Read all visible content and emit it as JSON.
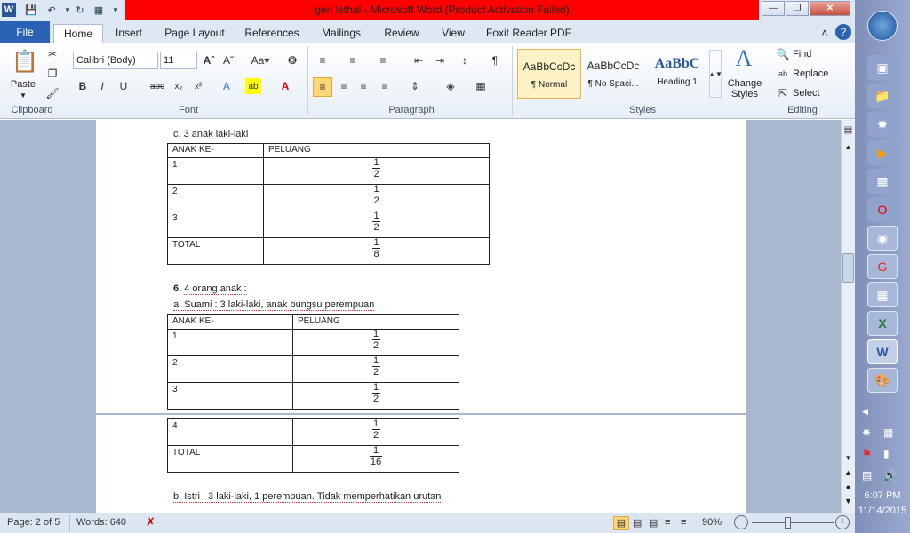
{
  "window": {
    "title": "gen lethal  -  Microsoft Word (Product Activation Failed)"
  },
  "qat": {
    "icons": [
      "word-icon",
      "save-icon",
      "undo-icon",
      "redo-icon",
      "customize-icon"
    ]
  },
  "tabs": [
    "File",
    "Home",
    "Insert",
    "Page Layout",
    "References",
    "Mailings",
    "Review",
    "View",
    "Foxit Reader PDF"
  ],
  "ribbon": {
    "clipboard": {
      "paste_label": "Paste",
      "group_label": "Clipboard"
    },
    "font": {
      "name": "Calibri (Body)",
      "size": "11",
      "group_label": "Font"
    },
    "paragraph": {
      "group_label": "Paragraph"
    },
    "styles": {
      "items": [
        {
          "preview": "AaBbCcDc",
          "name": "¶ Normal"
        },
        {
          "preview": "AaBbCcDc",
          "name": "¶ No Spaci..."
        },
        {
          "preview": "AaBbC",
          "name": "Heading 1"
        }
      ],
      "change_label": "Change Styles",
      "group_label": "Styles"
    },
    "editing": {
      "find": "Find",
      "replace": "Replace",
      "select": "Select",
      "group_label": "Editing"
    }
  },
  "document": {
    "c_heading": "c. 3 anak laki-laki",
    "table1": {
      "headers": [
        "ANAK KE-",
        "PELUANG"
      ],
      "rows": [
        {
          "label": "1",
          "num": "1",
          "den": "2"
        },
        {
          "label": "2",
          "num": "1",
          "den": "2"
        },
        {
          "label": "3",
          "num": "1",
          "den": "2"
        },
        {
          "label": "TOTAL",
          "num": "1",
          "den": "8"
        }
      ]
    },
    "six_num": "6.",
    "six_text": "4 orang anak :",
    "a_text": "a. Suami : 3 laki-laki, anak bungsu perempuan",
    "table2": {
      "headers": [
        "ANAK KE-",
        "PELUANG"
      ],
      "rows": [
        {
          "label": "1",
          "num": "1",
          "den": "2"
        },
        {
          "label": "2",
          "num": "1",
          "den": "2"
        },
        {
          "label": "3",
          "num": "1",
          "den": "2"
        }
      ]
    },
    "table3": {
      "rows": [
        {
          "label": "4",
          "num": "1",
          "den": "2"
        },
        {
          "label": "TOTAL",
          "num": "1",
          "den": "16"
        }
      ]
    },
    "b_text": "b. Istri : 3 laki-laki, 1 perempuan. Tidak memperhatikan urutan"
  },
  "status": {
    "page": "Page: 2 of 5",
    "words": "Words: 640",
    "zoom": "90%"
  },
  "taskbar": {
    "time": "6:07 PM",
    "date": "11/14/2015"
  }
}
